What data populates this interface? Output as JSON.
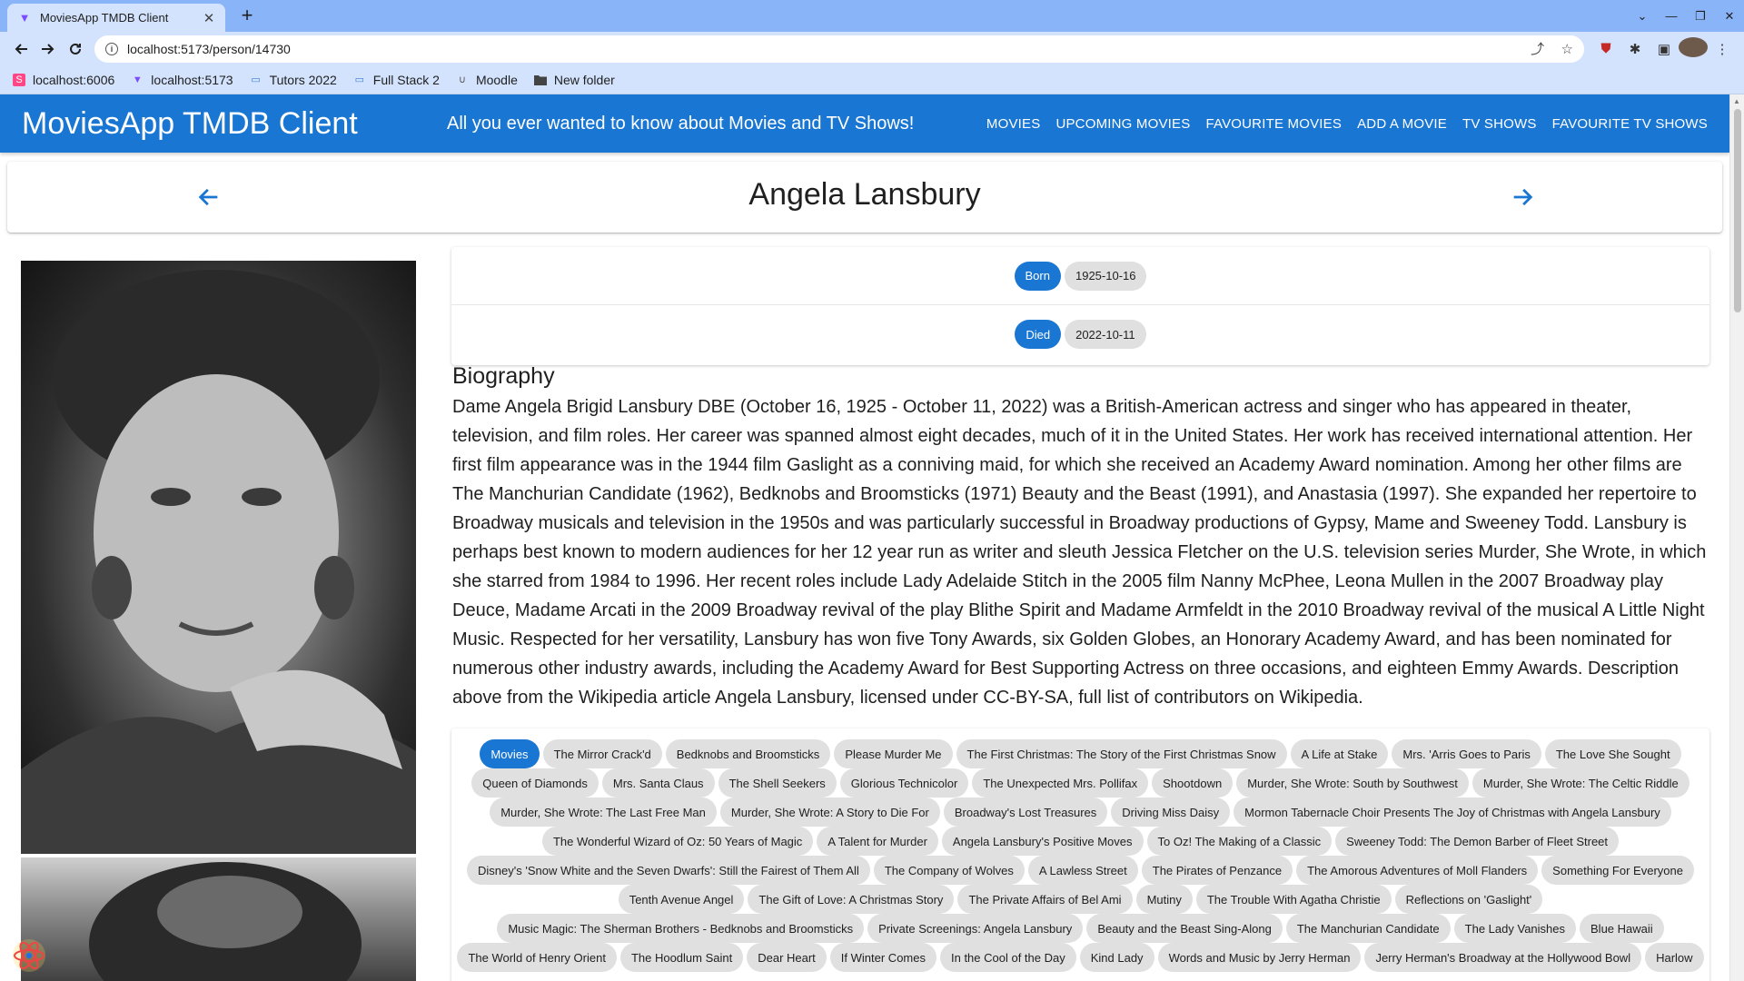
{
  "browser": {
    "tab_title": "MoviesApp TMDB Client",
    "tab_close": "✕",
    "new_tab": "+",
    "url_prefix": "localhost",
    "url": "localhost:5173/person/14730",
    "window_controls": [
      "⌄",
      "—",
      "❐",
      "✕"
    ]
  },
  "bookmarks": [
    {
      "label": "localhost:6006",
      "icon": "storybook-icon"
    },
    {
      "label": "localhost:5173",
      "icon": "vite-icon"
    },
    {
      "label": "Tutors 2022",
      "icon": "tutors-icon"
    },
    {
      "label": "Full Stack 2",
      "icon": "tutors-icon"
    },
    {
      "label": "Moodle",
      "icon": "moodle-icon"
    },
    {
      "label": "New folder",
      "icon": "folder-icon"
    }
  ],
  "appbar": {
    "title": "MoviesApp TMDB Client",
    "tagline": "All you ever wanted to know about Movies and TV Shows!",
    "nav": [
      "Movies",
      "Upcoming Movies",
      "Favourite Movies",
      "Add a Movie",
      "TV Shows",
      "Favourite TV Shows"
    ]
  },
  "person": {
    "name": "Angela Lansbury",
    "born_label": "Born",
    "born_date": "1925-10-16",
    "died_label": "Died",
    "died_date": "2022-10-11",
    "bio_heading": "Biography",
    "biography": "Dame Angela Brigid Lansbury DBE (October 16, 1925 - October 11, 2022) was a British-American actress and singer who has appeared in theater, television, and film roles. Her career was spanned almost eight decades, much of it in the United States. Her work has received international attention. Her first film appearance was in the 1944 film Gaslight as a conniving maid, for which she received an Academy Award nomination. Among her other films are The Manchurian Candidate (1962), Bedknobs and Broomsticks (1971) Beauty and the Beast (1991), and Anastasia (1997). She expanded her repertoire to Broadway musicals and television in the 1950s and was particularly successful in Broadway productions of Gypsy, Mame and Sweeney Todd. Lansbury is perhaps best known to modern audiences for her 12 year run as writer and sleuth Jessica Fletcher on the U.S. television series Murder, She Wrote, in which she starred from 1984 to 1996. Her recent roles include Lady Adelaide Stitch in the 2005 film Nanny McPhee, Leona Mullen in the 2007 Broadway play Deuce, Madame Arcati in the 2009 Broadway revival of the play Blithe Spirit and Madame Armfeldt in the 2010 Broadway revival of the musical A Little Night Music. Respected for her versatility, Lansbury has won five Tony Awards, six Golden Globes, an Honorary Academy Award, and has been nominated for numerous other industry awards, including the Academy Award for Best Supporting Actress on three occasions, and eighteen Emmy Awards. Description above from the Wikipedia article Angela Lansbury, licensed under CC-BY-SA, full list of contributors on Wikipedia."
  },
  "credits": {
    "label": "Movies",
    "rows": [
      [
        "The Mirror Crack'd",
        "Bedknobs and Broomsticks",
        "Please Murder Me",
        "The First Christmas: The Story of the First Christmas Snow",
        "A Life at Stake",
        "Mrs. 'Arris Goes to Paris",
        "The Love She Sought"
      ],
      [
        "Queen of Diamonds",
        "Mrs. Santa Claus",
        "The Shell Seekers",
        "Glorious Technicolor",
        "The Unexpected Mrs. Pollifax",
        "Shootdown",
        "Murder, She Wrote: South by Southwest",
        "Murder, She Wrote: The Celtic Riddle"
      ],
      [
        "Murder, She Wrote: The Last Free Man",
        "Murder, She Wrote: A Story to Die For",
        "Broadway's Lost Treasures",
        "Driving Miss Daisy",
        "Mormon Tabernacle Choir Presents The Joy of Christmas with Angela Lansbury"
      ],
      [
        "The Wonderful Wizard of Oz: 50 Years of Magic",
        "A Talent for Murder",
        "Angela Lansbury's Positive Moves",
        "To Oz! The Making of a Classic",
        "Sweeney Todd: The Demon Barber of Fleet Street"
      ],
      [
        "Disney's 'Snow White and the Seven Dwarfs': Still the Fairest of Them All",
        "The Company of Wolves",
        "A Lawless Street",
        "The Pirates of Penzance",
        "The Amorous Adventures of Moll Flanders",
        "Something For Everyone"
      ],
      [
        "Tenth Avenue Angel",
        "The Gift of Love: A Christmas Story",
        "The Private Affairs of Bel Ami",
        "Mutiny",
        "The Trouble With Agatha Christie",
        "Reflections on 'Gaslight'"
      ],
      [
        "Music Magic: The Sherman Brothers - Bedknobs and Broomsticks",
        "Private Screenings: Angela Lansbury",
        "Beauty and the Beast Sing-Along",
        "The Manchurian Candidate",
        "The Lady Vanishes",
        "Blue Hawaii"
      ],
      [
        "The World of Henry Orient",
        "The Hoodlum Saint",
        "Dear Heart",
        "If Winter Comes",
        "In the Cool of the Day",
        "Kind Lady",
        "Words and Music by Jerry Herman",
        "Jerry Herman's Broadway at the Hollywood Bowl",
        "Harlow"
      ]
    ]
  },
  "colors": {
    "primary": "#1976d2",
    "chip_bg": "#e0e0e0",
    "browser_frame": "#d3e3fd"
  }
}
